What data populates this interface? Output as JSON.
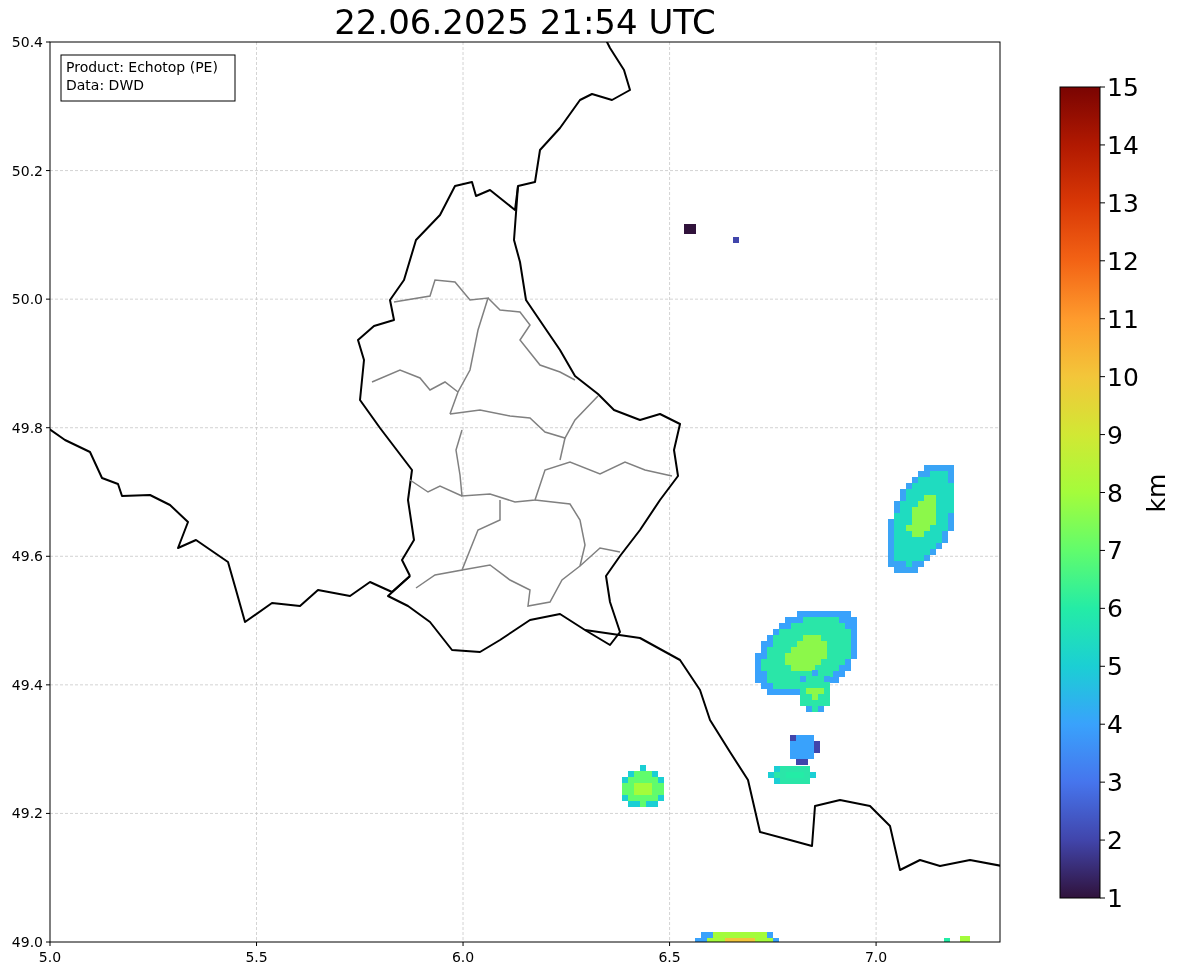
{
  "figure": {
    "title": "22.06.2025 21:54 UTC",
    "info_box": [
      "Product: Echotop (PE)",
      "Data: DWD"
    ],
    "xticks": [
      "5.0",
      "5.5",
      "6.0",
      "6.5",
      "7.0"
    ],
    "yticks": [
      "50.4",
      "50.2",
      "50.0",
      "49.8",
      "49.6",
      "49.4",
      "49.2",
      "49.0"
    ]
  },
  "colorbar": {
    "label": "km",
    "ticks": [
      "15",
      "14",
      "13",
      "12",
      "11",
      "10",
      "9",
      "8",
      "7",
      "6",
      "5",
      "4",
      "3",
      "2",
      "1"
    ]
  }
}
